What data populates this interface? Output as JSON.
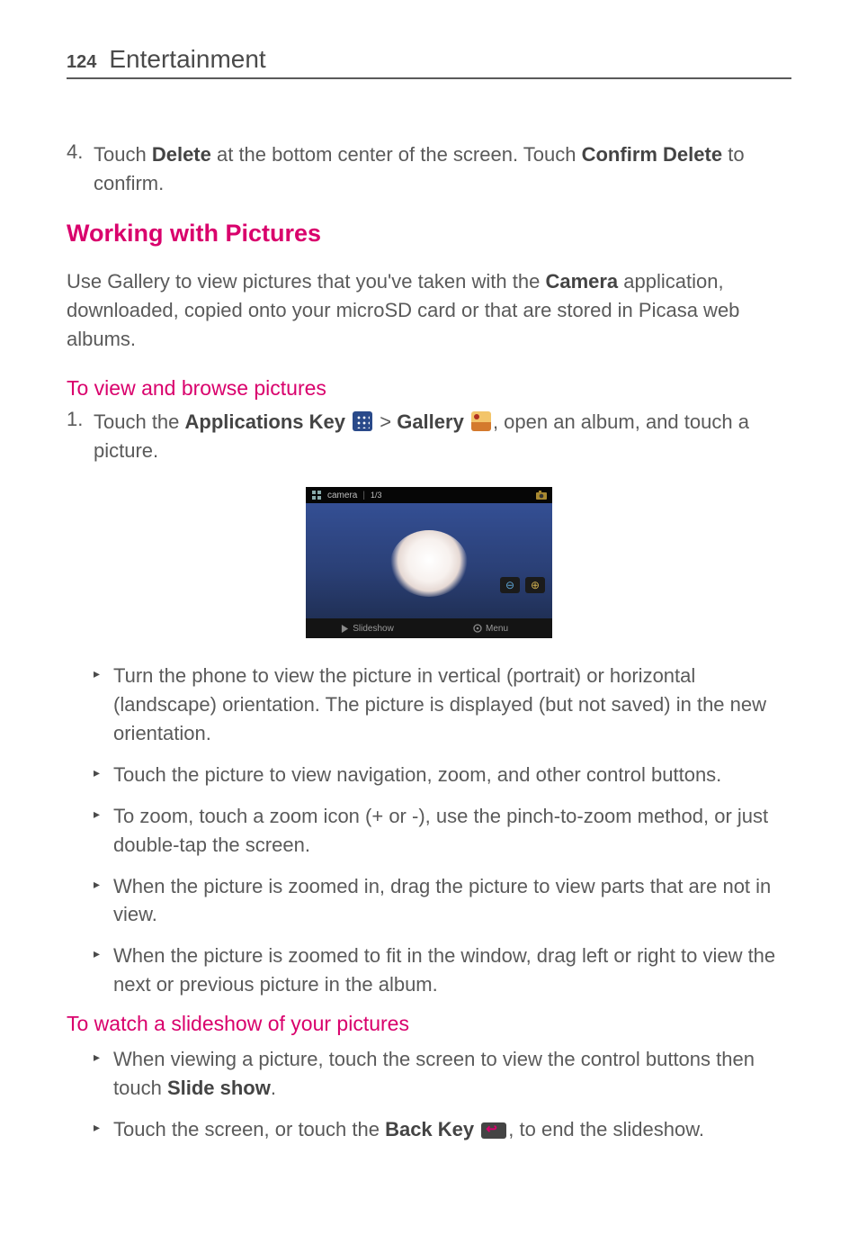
{
  "header": {
    "page_number": "124",
    "title": "Entertainment"
  },
  "step4": {
    "marker": "4.",
    "lead": " Touch ",
    "strong1": "Delete",
    "mid": " at the bottom center of the screen. Touch ",
    "strong2": "Confirm Delete",
    "tail": " to confirm."
  },
  "h2": "Working with Pictures",
  "intro": {
    "a": "Use Gallery to view pictures that you've taken with the ",
    "camera": "Camera",
    "b": " application, downloaded, copied onto your microSD card or that are stored in Picasa web albums."
  },
  "h3a": "To view and browse pictures",
  "step1": {
    "marker": "1.",
    "a": " Touch the ",
    "apps": "Applications Key",
    "gt": " > ",
    "gallery": "Gallery",
    "b": ", open an album, and touch a picture."
  },
  "screenshot": {
    "album_title": "camera",
    "counter": "1/3",
    "zoom_out": "⊖",
    "zoom_in": "⊕",
    "btn_slideshow": "Slideshow",
    "btn_menu": "Menu"
  },
  "bullets_a": {
    "b1": "Turn the phone to view the picture in vertical (portrait) or horizontal (landscape) orientation. The picture is displayed (but not saved) in the new orientation.",
    "b2": "Touch the picture to view navigation, zoom, and other control buttons.",
    "b3": "To zoom, touch a zoom icon (+ or -), use the pinch-to-zoom method, or just double-tap the screen.",
    "b4": "When the picture is zoomed in, drag the picture to view parts that are not in view.",
    "b5": "When the picture is zoomed to fit in the window, drag left or right to view the next or previous picture in the album."
  },
  "h3b": "To watch a slideshow of your pictures",
  "bullets_b": {
    "b1a": "When viewing a picture, touch the screen to view the control buttons then touch ",
    "b1s": "Slide show",
    "b1b": ".",
    "b2a": "Touch the screen, or touch the ",
    "b2s": "Back Key",
    "b2b": ", to end the slideshow."
  },
  "markers": {
    "tri": "▸"
  }
}
